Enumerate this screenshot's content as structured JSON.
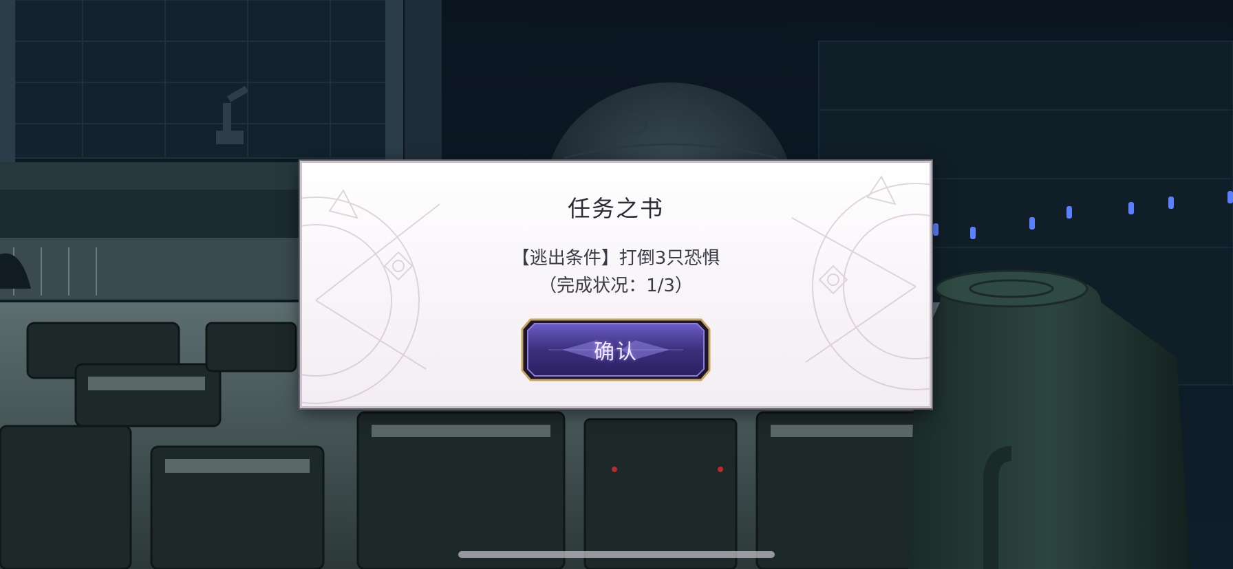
{
  "dialog": {
    "title": "任务之书",
    "condition_text": "【逃出条件】打倒3只恐惧",
    "progress_text": "（完成状况：1/3）",
    "confirm_label": "确认"
  },
  "colors": {
    "dialog_bg": "#f7f3f7",
    "button_purple": "#4a3f8f",
    "button_gold": "#c9a55a",
    "scene_dark": "#0b1620"
  },
  "icons": {
    "ornament": "clock-compass-ornament",
    "home_indicator": "home-indicator-bar"
  }
}
